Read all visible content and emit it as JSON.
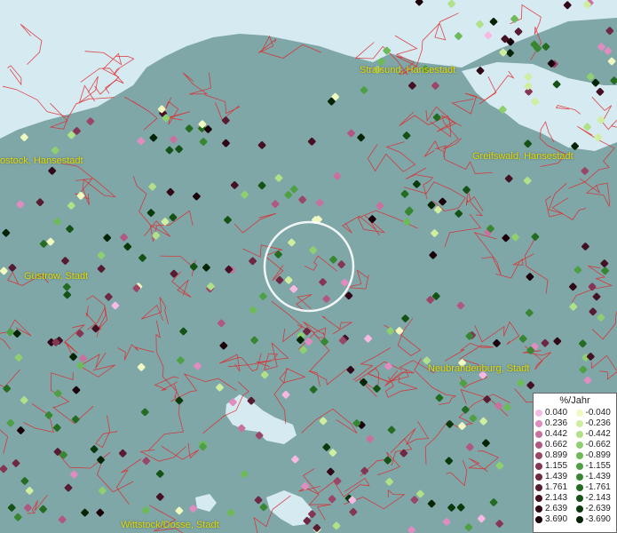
{
  "map": {
    "cities": [
      {
        "name": "Stralsund, Hansestadt"
      },
      {
        "name": "ostock, Hansestadt"
      },
      {
        "name": "Greifswald, Hansestadt"
      },
      {
        "name": "Güstrow, Stadt"
      },
      {
        "name": "Neubrandenburg, Stadt"
      },
      {
        "name": "Wittstock/Dosse, Stadt"
      }
    ],
    "colors": {
      "land": "#7fa7a8",
      "water": "#d6eaf1",
      "boundaries": "#e0282a",
      "highlight_circle": "#ffffff",
      "city_label": "#e6d800"
    }
  },
  "legend": {
    "title": "%/Jahr",
    "positive": [
      {
        "label": "0.040",
        "color": "#f7b8e4"
      },
      {
        "label": "0.236",
        "color": "#e08cc0"
      },
      {
        "label": "0.442",
        "color": "#c8709e"
      },
      {
        "label": "0.662",
        "color": "#b05880"
      },
      {
        "label": "0.899",
        "color": "#9a4668"
      },
      {
        "label": "1.155",
        "color": "#843654"
      },
      {
        "label": "1.439",
        "color": "#6e2842"
      },
      {
        "label": "1.761",
        "color": "#581c32"
      },
      {
        "label": "2.143",
        "color": "#441024"
      },
      {
        "label": "2.639",
        "color": "#300818"
      },
      {
        "label": "3.690",
        "color": "#1a0008"
      }
    ],
    "negative": [
      {
        "label": "-0.040",
        "color": "#f0fac0"
      },
      {
        "label": "-0.236",
        "color": "#cfeea0"
      },
      {
        "label": "-0.442",
        "color": "#b0e088"
      },
      {
        "label": "-0.662",
        "color": "#8ed070"
      },
      {
        "label": "-0.899",
        "color": "#6cba58"
      },
      {
        "label": "-1.155",
        "color": "#4fa044"
      },
      {
        "label": "-1.439",
        "color": "#388632"
      },
      {
        "label": "-1.761",
        "color": "#246c22"
      },
      {
        "label": "-2.143",
        "color": "#145216"
      },
      {
        "label": "-2.639",
        "color": "#0a3a0c"
      },
      {
        "label": "-3.690",
        "color": "#042406"
      }
    ]
  }
}
